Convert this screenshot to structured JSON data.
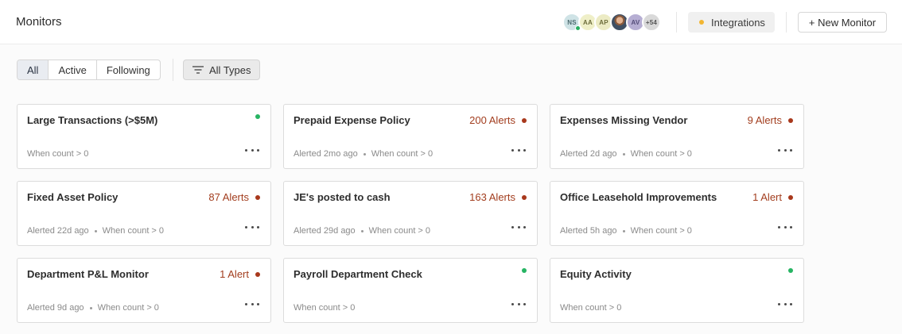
{
  "header": {
    "title": "Monitors",
    "avatars": [
      {
        "initials": "NS",
        "bg": "#cfe3e6",
        "fg": "#4d6b70",
        "presence": "#27ae60",
        "icon": ""
      },
      {
        "initials": "AA",
        "bg": "#efefc8",
        "fg": "#6d6d3c",
        "presence": "",
        "icon": ""
      },
      {
        "initials": "AP",
        "bg": "#ecebc4",
        "fg": "#6d6c3b",
        "presence": "",
        "icon": ""
      },
      {
        "initials": "",
        "bg": "",
        "fg": "",
        "presence": "",
        "icon": "user-photo"
      },
      {
        "initials": "AV",
        "bg": "#b6aed3",
        "fg": "#554d7a",
        "presence": "",
        "icon": ""
      },
      {
        "initials": "+54",
        "bg": "#d9d9d9",
        "fg": "#555555",
        "presence": "",
        "icon": ""
      }
    ],
    "integrations_label": "Integrations",
    "integrations_dot_color": "#f2b632",
    "new_monitor_label": "+ New Monitor"
  },
  "filters": {
    "tabs": [
      {
        "label": "All",
        "active": true
      },
      {
        "label": "Active",
        "active": false
      },
      {
        "label": "Following",
        "active": false
      }
    ],
    "types_label": "All Types",
    "types_icon": "filter-lines-icon"
  },
  "colors": {
    "alert_text": "#a23d1e",
    "alert_dot": "#a8381c",
    "ok_dot": "#27b463"
  },
  "monitors": [
    {
      "title": "Large Transactions (>$5M)",
      "alerts": "",
      "status": "ok",
      "alerted": "",
      "condition": "When count > 0"
    },
    {
      "title": "Prepaid Expense Policy",
      "alerts": "200 Alerts",
      "status": "alert",
      "alerted": "Alerted 2mo ago",
      "condition": "When count > 0"
    },
    {
      "title": "Expenses Missing Vendor",
      "alerts": "9 Alerts",
      "status": "alert",
      "alerted": "Alerted 2d ago",
      "condition": "When count > 0"
    },
    {
      "title": "Fixed Asset Policy",
      "alerts": "87 Alerts",
      "status": "alert",
      "alerted": "Alerted 22d ago",
      "condition": "When count > 0"
    },
    {
      "title": "JE's posted to cash",
      "alerts": "163 Alerts",
      "status": "alert",
      "alerted": "Alerted 29d ago",
      "condition": "When count > 0"
    },
    {
      "title": "Office Leasehold Improvements",
      "alerts": "1 Alert",
      "status": "alert",
      "alerted": "Alerted 5h ago",
      "condition": "When count > 0"
    },
    {
      "title": "Department P&L Monitor",
      "alerts": "1 Alert",
      "status": "alert",
      "alerted": "Alerted 9d ago",
      "condition": "When count > 0"
    },
    {
      "title": "Payroll Department Check",
      "alerts": "",
      "status": "ok",
      "alerted": "",
      "condition": "When count > 0"
    },
    {
      "title": "Equity Activity",
      "alerts": "",
      "status": "ok",
      "alerted": "",
      "condition": "When count > 0"
    }
  ]
}
